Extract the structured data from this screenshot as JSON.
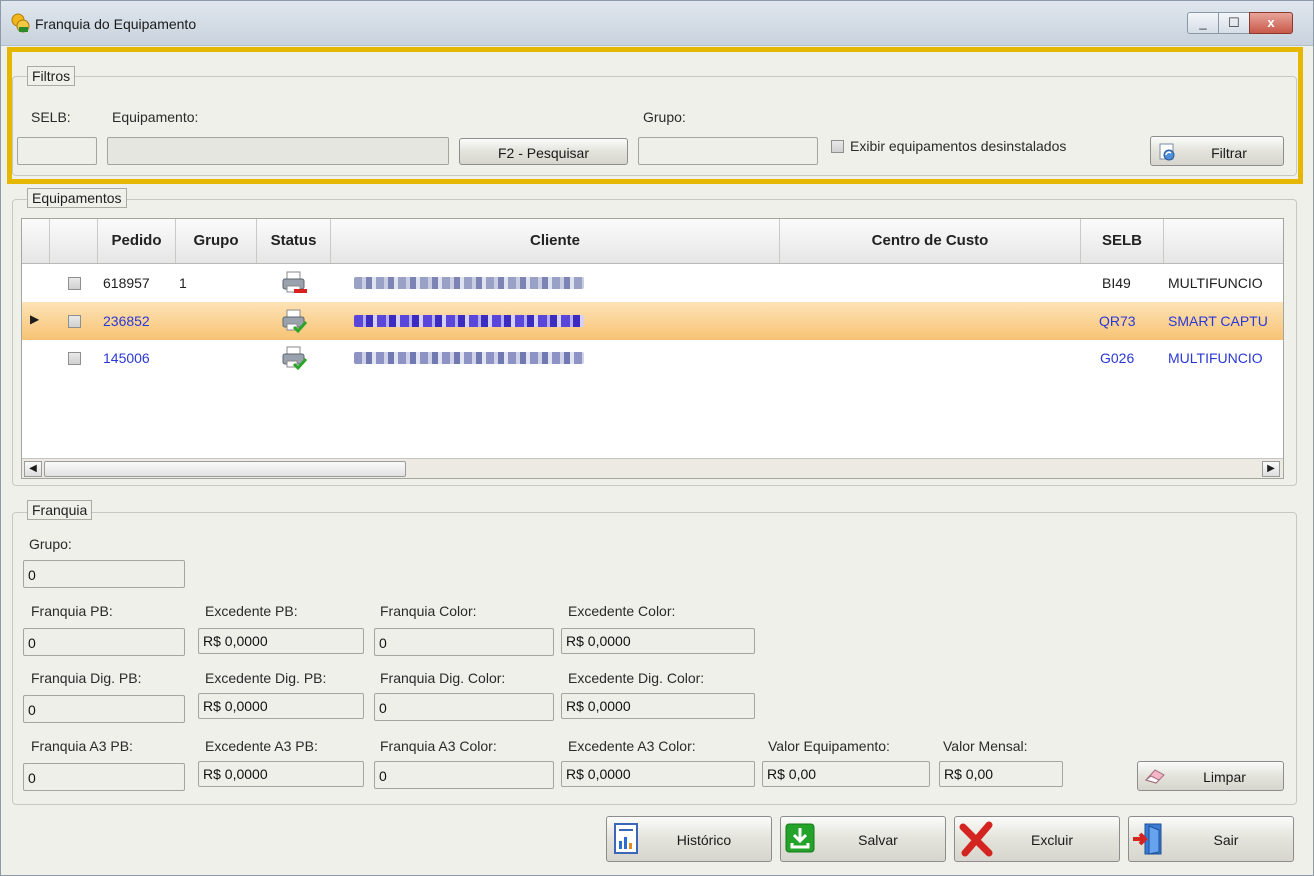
{
  "window": {
    "title": "Franquia do Equipamento",
    "min_glyph": "_",
    "max_glyph": "☐",
    "close_glyph": "x"
  },
  "filtros": {
    "legend": "Filtros",
    "selb_label": "SELB:",
    "selb_value": "",
    "equipamento_label": "Equipamento:",
    "equipamento_value": "",
    "pesquisar_label": "F2 - Pesquisar",
    "grupo_label": "Grupo:",
    "grupo_value": "",
    "exibir_label": "Exibir equipamentos desinstalados",
    "exibir_checked": false,
    "filtrar_label": "Filtrar"
  },
  "equipamentos": {
    "legend": "Equipamentos",
    "columns": [
      "Pedido",
      "Grupo",
      "Status",
      "Cliente",
      "Centro de Custo",
      "SELB"
    ],
    "rows": [
      {
        "pedido": "618957",
        "grupo": "1",
        "status": "printer-removed-icon",
        "cliente": "",
        "centro": "",
        "selb": "BI49",
        "extra": "MULTIFUNCIO",
        "selected": false,
        "color": "#222222"
      },
      {
        "pedido": "236852",
        "grupo": "",
        "status": "printer-ok-icon",
        "cliente": "",
        "centro": "",
        "selb": "QR73",
        "extra": "SMART CAPTU",
        "selected": true,
        "color": "#2a38d6"
      },
      {
        "pedido": "145006",
        "grupo": "",
        "status": "printer-ok-icon",
        "cliente": "",
        "centro": "",
        "selb": "G026",
        "extra": "MULTIFUNCIO",
        "selected": false,
        "color": "#2a38d6"
      }
    ]
  },
  "franquia": {
    "legend": "Franquia",
    "grupo_label": "Grupo:",
    "grupo_value": "0",
    "row1": [
      {
        "label": "Franquia PB:",
        "value": "0"
      },
      {
        "label": "Excedente PB:",
        "value": "R$ 0,0000"
      },
      {
        "label": "Franquia Color:",
        "value": "0"
      },
      {
        "label": "Excedente Color:",
        "value": "R$ 0,0000"
      }
    ],
    "row2": [
      {
        "label": "Franquia Dig. PB:",
        "value": "0"
      },
      {
        "label": "Excedente Dig. PB:",
        "value": "R$ 0,0000"
      },
      {
        "label": "Franquia Dig. Color:",
        "value": "0"
      },
      {
        "label": "Excedente Dig. Color:",
        "value": "R$ 0,0000"
      }
    ],
    "row3": [
      {
        "label": "Franquia A3 PB:",
        "value": "0"
      },
      {
        "label": "Excedente A3 PB:",
        "value": "R$ 0,0000"
      },
      {
        "label": "Franquia A3 Color:",
        "value": "0"
      },
      {
        "label": "Excedente A3 Color:",
        "value": "R$ 0,0000"
      },
      {
        "label": "Valor Equipamento:",
        "value": "R$ 0,00"
      },
      {
        "label": "Valor Mensal:",
        "value": "R$ 0,00"
      }
    ],
    "limpar_label": "Limpar"
  },
  "actions": {
    "historico": "Histórico",
    "salvar": "Salvar",
    "excluir": "Excluir",
    "sair": "Sair"
  },
  "colors": {
    "highlight": "#e6b700",
    "selected_row": "#f8c374",
    "link_blue": "#2a38d6"
  }
}
